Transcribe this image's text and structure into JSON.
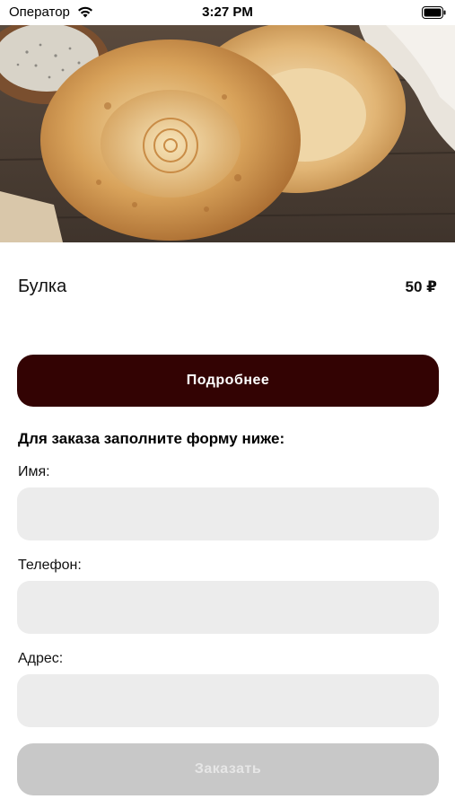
{
  "status_bar": {
    "carrier": "Оператор",
    "time": "3:27 PM"
  },
  "hero": {
    "icon": "bread-photo"
  },
  "product": {
    "name": "Булка",
    "price": "50 ₽"
  },
  "details_button": {
    "label": "Подробнее",
    "color": "#330303"
  },
  "form": {
    "heading": "Для заказа заполните форму ниже:",
    "fields": [
      {
        "label": "Имя:",
        "value": "",
        "placeholder": ""
      },
      {
        "label": "Телефон:",
        "value": "",
        "placeholder": ""
      },
      {
        "label": "Адрес:",
        "value": "",
        "placeholder": ""
      }
    ]
  },
  "order_button": {
    "label": "Заказать",
    "state": "disabled"
  }
}
